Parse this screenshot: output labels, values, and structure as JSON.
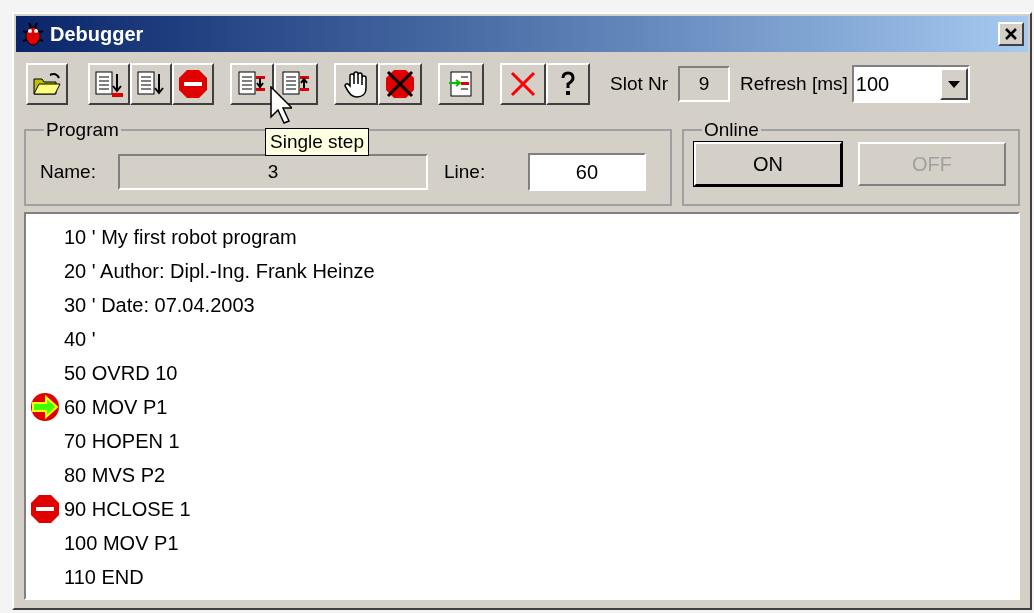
{
  "window": {
    "title": "Debugger"
  },
  "toolbar": {
    "tooltip": "Single step",
    "slot_label": "Slot Nr",
    "slot_value": "9",
    "refresh_label": "Refresh [ms]",
    "refresh_value": "100"
  },
  "program": {
    "title": "Program",
    "name_label": "Name:",
    "name_value": "3",
    "line_label": "Line:",
    "line_value": "60"
  },
  "online": {
    "title": "Online",
    "buttons": [
      {
        "label": "ON",
        "disabled": false
      },
      {
        "label": "OFF",
        "disabled": true
      }
    ]
  },
  "listing": [
    {
      "text": "10 ' My first robot program",
      "kind": "plain"
    },
    {
      "text": "20 ' Author: Dipl.-Ing. Frank Heinze",
      "kind": "plain"
    },
    {
      "text": "30 ' Date: 07.04.2003",
      "kind": "plain"
    },
    {
      "text": "40 '",
      "kind": "plain"
    },
    {
      "text": "50 OVRD 10",
      "kind": "plain"
    },
    {
      "text": "60 MOV P1",
      "kind": "current"
    },
    {
      "text": "70 HOPEN 1",
      "kind": "plain"
    },
    {
      "text": "80 MVS P2",
      "kind": "plain"
    },
    {
      "text": "90 HCLOSE 1",
      "kind": "breakpoint"
    },
    {
      "text": "100 MOV P1",
      "kind": "plain"
    },
    {
      "text": "110 END",
      "kind": "plain"
    }
  ]
}
